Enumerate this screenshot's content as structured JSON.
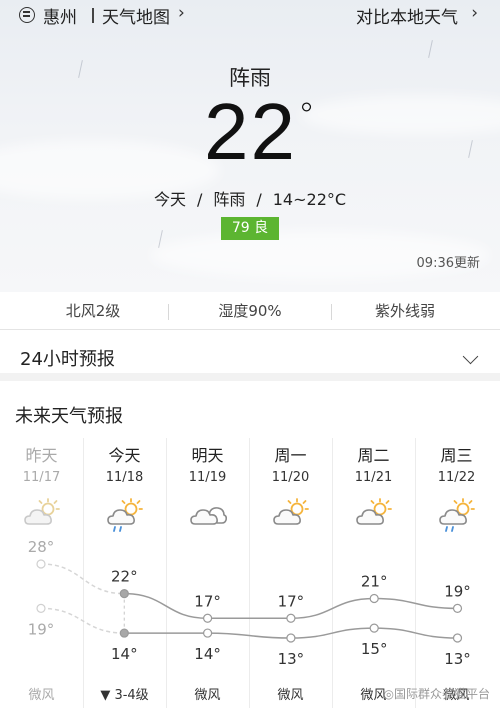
{
  "header": {
    "city": "惠州",
    "map_link": "天气地图",
    "compare_link": "对比本地天气"
  },
  "current": {
    "condition": "阵雨",
    "temperature": "22°",
    "today_label": "今天",
    "today_condition": "阵雨",
    "today_range": "14~22°C",
    "aqi": "79 良",
    "updated": "09:36更新"
  },
  "stats": [
    {
      "label": "北风2级"
    },
    {
      "label": "湿度90%"
    },
    {
      "label": "紫外线弱"
    }
  ],
  "hourly": {
    "title": "24小时预报"
  },
  "forecast": {
    "title": "未来天气预报",
    "days": [
      {
        "name": "昨天",
        "date": "11/17",
        "high": "28°",
        "low": "19°",
        "wind": "微风",
        "icon": "partly-cloudy-icon",
        "past": true
      },
      {
        "name": "今天",
        "date": "11/18",
        "high": "22°",
        "low": "14°",
        "wind": "▼ 3-4级",
        "icon": "partly-cloudy-rain-icon",
        "past": false
      },
      {
        "name": "明天",
        "date": "11/19",
        "high": "17°",
        "low": "14°",
        "wind": "微风",
        "icon": "cloudy-icon",
        "past": false
      },
      {
        "name": "周一",
        "date": "11/20",
        "high": "17°",
        "low": "13°",
        "wind": "微风",
        "icon": "partly-cloudy-icon",
        "past": false
      },
      {
        "name": "周二",
        "date": "11/21",
        "high": "21°",
        "low": "15°",
        "wind": "微风",
        "icon": "partly-cloudy-icon",
        "past": false
      },
      {
        "name": "周三",
        "date": "11/22",
        "high": "19°",
        "low": "13°",
        "wind": "微风",
        "icon": "partly-cloudy-rain-icon",
        "past": false
      }
    ]
  },
  "chart_data": {
    "type": "line",
    "categories": [
      "昨天",
      "今天",
      "明天",
      "周一",
      "周二",
      "周三"
    ],
    "series": [
      {
        "values": [
          28,
          22,
          17,
          17,
          21,
          19
        ]
      },
      {
        "values": [
          19,
          14,
          14,
          13,
          15,
          13
        ]
      }
    ]
  },
  "watermark": "国际群众养猫平台",
  "colors": {
    "aqi_good": "#5cb531",
    "sun": "#f5b43c",
    "rain": "#4a90d9",
    "line": "#9a9a9a"
  }
}
